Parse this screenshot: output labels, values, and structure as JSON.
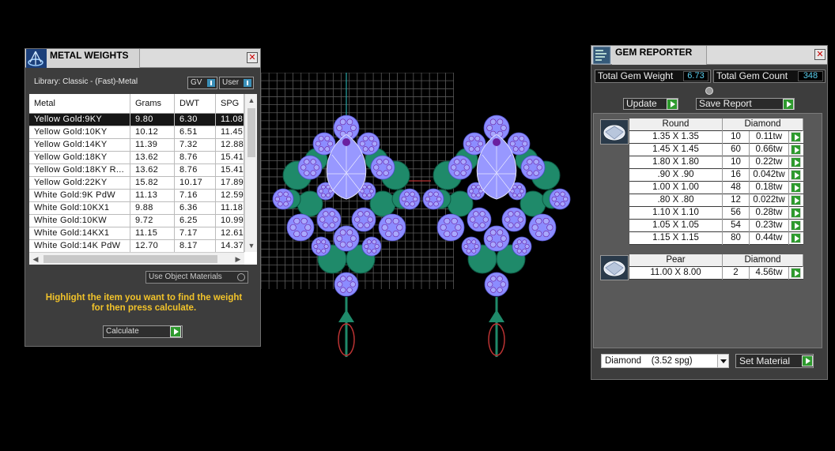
{
  "metal_weights": {
    "title": "METAL WEIGHTS",
    "library_label": "Library: Classic - (Fast)-Metal",
    "toggle_gv": "GV",
    "toggle_user": "User",
    "columns": [
      "Metal",
      "Grams",
      "DWT",
      "SPG"
    ],
    "rows": [
      [
        "Yellow Gold:9KY",
        "9.80",
        "6.30",
        "11.08"
      ],
      [
        "Yellow Gold:10KY",
        "10.12",
        "6.51",
        "11.45"
      ],
      [
        "Yellow Gold:14KY",
        "11.39",
        "7.32",
        "12.88"
      ],
      [
        "Yellow Gold:18KY",
        "13.62",
        "8.76",
        "15.41"
      ],
      [
        "Yellow Gold:18KY R...",
        "13.62",
        "8.76",
        "15.41"
      ],
      [
        "Yellow Gold:22KY",
        "15.82",
        "10.17",
        "17.89"
      ],
      [
        "White Gold:9K PdW",
        "11.13",
        "7.16",
        "12.59"
      ],
      [
        "White Gold:10KX1",
        "9.88",
        "6.36",
        "11.18"
      ],
      [
        "White Gold:10KW",
        "9.72",
        "6.25",
        "10.99"
      ],
      [
        "White Gold:14KX1",
        "11.15",
        "7.17",
        "12.61"
      ],
      [
        "White Gold:14K PdW",
        "12.70",
        "8.17",
        "14.37"
      ]
    ],
    "selected_row": 0,
    "use_object_materials": "Use Object Materials",
    "hint_line1": "Highlight the item you want to find the weight",
    "hint_line2": "for then press calculate.",
    "calculate_label": "Calculate"
  },
  "gem_reporter": {
    "title": "GEM REPORTER",
    "total_weight_label": "Total Gem Weight",
    "total_weight_value": "6.73",
    "total_count_label": "Total Gem Count",
    "total_count_value": "348",
    "update_label": "Update",
    "save_report_label": "Save Report",
    "groups": [
      {
        "shape": "Round",
        "material": "Diamond",
        "rows": [
          [
            "1.35 X 1.35",
            "10",
            "0.11tw"
          ],
          [
            "1.45 X 1.45",
            "60",
            "0.66tw"
          ],
          [
            "1.80 X 1.80",
            "10",
            "0.22tw"
          ],
          [
            ".90 X .90",
            "16",
            "0.042tw"
          ],
          [
            "1.00 X 1.00",
            "48",
            "0.18tw"
          ],
          [
            ".80 X .80",
            "12",
            "0.022tw"
          ],
          [
            "1.10 X 1.10",
            "56",
            "0.28tw"
          ],
          [
            "1.05 X 1.05",
            "54",
            "0.23tw"
          ],
          [
            "1.15 X 1.15",
            "80",
            "0.44tw"
          ]
        ]
      },
      {
        "shape": "Pear",
        "material": "Diamond",
        "rows": [
          [
            "11.00 X 8.00",
            "2",
            "4.56tw"
          ]
        ]
      }
    ],
    "material_select": "Diamond    (3.52 spg)",
    "set_material_label": "Set Material"
  },
  "colors": {
    "gem_blue": "#8c8cff",
    "setting_teal": "#1f8a6a",
    "prong_purple": "#6a1fa0",
    "hint_yellow": "#f2c32a",
    "accent_green": "#2e9a2e"
  }
}
